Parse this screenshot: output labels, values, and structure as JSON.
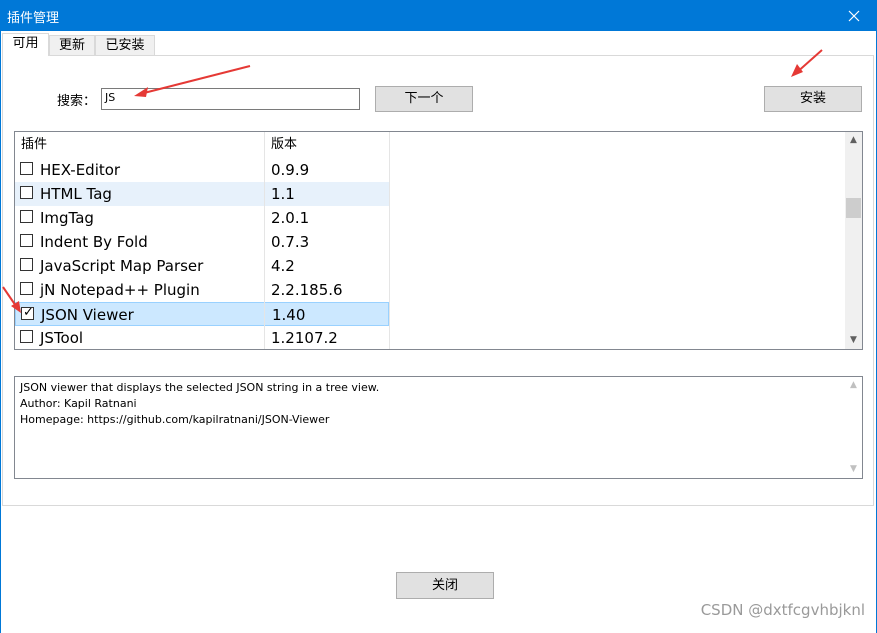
{
  "window": {
    "title": "插件管理"
  },
  "tabs": [
    {
      "label": "可用"
    },
    {
      "label": "更新"
    },
    {
      "label": "已安装"
    }
  ],
  "search": {
    "label": "搜索：",
    "value": "JS"
  },
  "buttons": {
    "next": "下一个",
    "install": "安装",
    "close": "关闭"
  },
  "list": {
    "columns": [
      "插件",
      "版本"
    ],
    "rows": [
      {
        "name": "HEX-Editor",
        "version": "0.9.9",
        "checked": false
      },
      {
        "name": "HTML Tag",
        "version": "1.1",
        "checked": false
      },
      {
        "name": "ImgTag",
        "version": "2.0.1",
        "checked": false
      },
      {
        "name": "Indent By Fold",
        "version": "0.7.3",
        "checked": false
      },
      {
        "name": "JavaScript Map Parser",
        "version": "4.2",
        "checked": false
      },
      {
        "name": "jN Notepad++ Plugin",
        "version": "2.2.185.6",
        "checked": false
      },
      {
        "name": "JSON Viewer",
        "version": "1.40",
        "checked": true
      },
      {
        "name": "JSTool",
        "version": "1.2107.2",
        "checked": false
      }
    ]
  },
  "description": {
    "lines": [
      "JSON viewer that displays the selected JSON string in a tree view.",
      "Author: Kapil Ratnani",
      "Homepage: https://github.com/kapilratnani/JSON-Viewer"
    ]
  },
  "watermark": "CSDN @dxtfcgvhbjknl",
  "colors": {
    "titlebar": "#0078d7",
    "selection": "#cce8ff",
    "annotation_arrow": "#e53935"
  },
  "icons": {
    "close": "close-icon",
    "check": "checkmark-icon",
    "scroll_up": "chevron-up-icon",
    "scroll_down": "chevron-down-icon"
  }
}
